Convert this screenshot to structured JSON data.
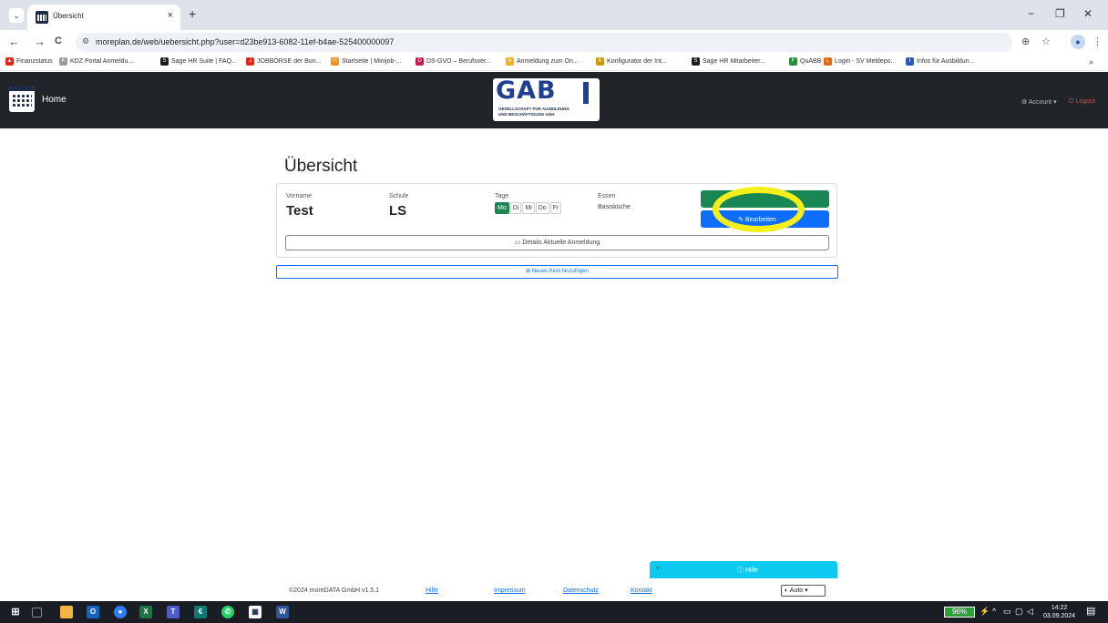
{
  "browser": {
    "tab_title": "Übersicht",
    "tab_close": "×",
    "new_tab": "+",
    "url": "moreplan.de/web/uebersicht.php?user=d23be913-6082-11ef-b4ae-525400000097",
    "back": "←",
    "forward": "→",
    "reload": "C",
    "window_min": "−",
    "window_max": "❐",
    "window_close": "✕",
    "menu": "⋮",
    "star": "☆",
    "zoom": "⊕",
    "bookmarks_more": "»"
  },
  "bookmarks": [
    {
      "label": "Finanzstatus",
      "color": "#e2241a",
      "glyph": "▲"
    },
    {
      "label": "KDZ Portal Anmeldu...",
      "color": "#9a9a9a",
      "glyph": "K"
    },
    {
      "label": "Sage HR Suite | FAQ...",
      "color": "#1d1d1d",
      "glyph": "S"
    },
    {
      "label": "JOBBÖRSE der Bun...",
      "color": "#e2241a",
      "glyph": "J"
    },
    {
      "label": "Startseite | Minijob-...",
      "color": "#f08c1c",
      "glyph": "m"
    },
    {
      "label": "DS-GVO – Berufsver...",
      "color": "#c21a4b",
      "glyph": "D"
    },
    {
      "label": "Anmeldung zum On...",
      "color": "#f0b21c",
      "glyph": "A"
    },
    {
      "label": "Konfigurator der Int...",
      "color": "#c89614",
      "glyph": "K"
    },
    {
      "label": "Sage HR Mitarbeiter...",
      "color": "#1d1d1d",
      "glyph": "S"
    },
    {
      "label": "QuABB",
      "color": "#2a8a3a",
      "glyph": "F"
    },
    {
      "label": "Login - SV Meldepo...",
      "color": "#e06a1a",
      "glyph": "L"
    },
    {
      "label": "Infos für Ausbildun...",
      "color": "#2a5ab8",
      "glyph": "I"
    }
  ],
  "navbar": {
    "home": "Home",
    "logo_big": "GAB",
    "logo_line1": "GESELLSCHAFT FÜR AUSBILDUNG",
    "logo_line2": "UND BESCHÄFTIGUNG mbH",
    "account": "⚙ Account ▾",
    "logout": "⏻ Logout"
  },
  "main": {
    "title": "Übersicht",
    "card": {
      "vorname_label": "Vorname",
      "vorname": "Test",
      "schule_label": "Schule",
      "schule": "LS",
      "tage_label": "Tage",
      "days": [
        {
          "label": "Mo",
          "active": true
        },
        {
          "label": "Di",
          "active": false
        },
        {
          "label": "Mi",
          "active": false
        },
        {
          "label": "Do",
          "active": false
        },
        {
          "label": "Fr",
          "active": false
        }
      ],
      "essen_label": "Essen",
      "essen": "Basisküche",
      "edit_button": "✎ Bearbeiten",
      "details_button": "▭ Details Aktuelle Anmeldung"
    },
    "add_child_button": "⊞ Neues Kind hinzufügen"
  },
  "help": {
    "arrow": "▿",
    "label": "ⓘ Hilfe"
  },
  "footer": {
    "copyright": "©2024 moreDATA GmbH v1.5.1",
    "links": [
      "Hilfe",
      "Impressum",
      "Datenschutz",
      "Kontakt"
    ],
    "theme": "◐ Auto ▾"
  },
  "taskbar": {
    "battery": "96%",
    "time": "14:22",
    "date": "03.09.2024"
  },
  "colors": {
    "navbar": "#212529",
    "green": "#198754",
    "blue": "#0d6efd",
    "help": "#0dcaf0",
    "highlight": "#f4ee1a"
  }
}
